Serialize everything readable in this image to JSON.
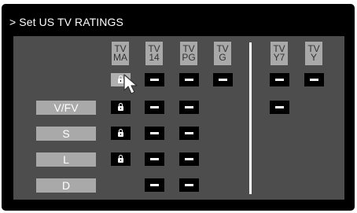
{
  "screen": {
    "title": "> Set US TV RATINGS"
  },
  "columns": [
    {
      "line1": "TV",
      "line2": "MA"
    },
    {
      "line1": "TV",
      "line2": "14"
    },
    {
      "line1": "TV",
      "line2": "PG"
    },
    {
      "line1": "TV",
      "line2": "G"
    },
    {
      "line1": "TV",
      "line2": "Y7"
    },
    {
      "line1": "TV",
      "line2": "Y"
    }
  ],
  "rows": [
    {
      "label": ""
    },
    {
      "label": "V/FV"
    },
    {
      "label": "S"
    },
    {
      "label": "L"
    },
    {
      "label": "D"
    }
  ],
  "grid": {
    "age_row": [
      "locked",
      "unlocked",
      "unlocked",
      "unlocked",
      "unlocked",
      "unlocked"
    ],
    "vfv_row": [
      "locked",
      "unlocked",
      "unlocked",
      null,
      "unlocked",
      null
    ],
    "s_row": [
      "locked",
      "unlocked",
      "unlocked",
      null,
      null,
      null
    ],
    "l_row": [
      "locked",
      "unlocked",
      "unlocked",
      null,
      null,
      null
    ],
    "d_row": [
      null,
      "unlocked",
      "unlocked",
      null,
      null,
      null
    ]
  },
  "selection": {
    "row": "age_row",
    "column": "TV MA"
  },
  "colors": {
    "background": "#000000",
    "panel": "#4d4d4d",
    "header_box": "#a9a9a9",
    "label_box": "#a9a9a9",
    "selected_cell": "#b0b0b0"
  },
  "icons": {
    "lock": "padlock-icon",
    "unlocked": "dash-icon",
    "pointer": "mouse-pointer-icon"
  }
}
